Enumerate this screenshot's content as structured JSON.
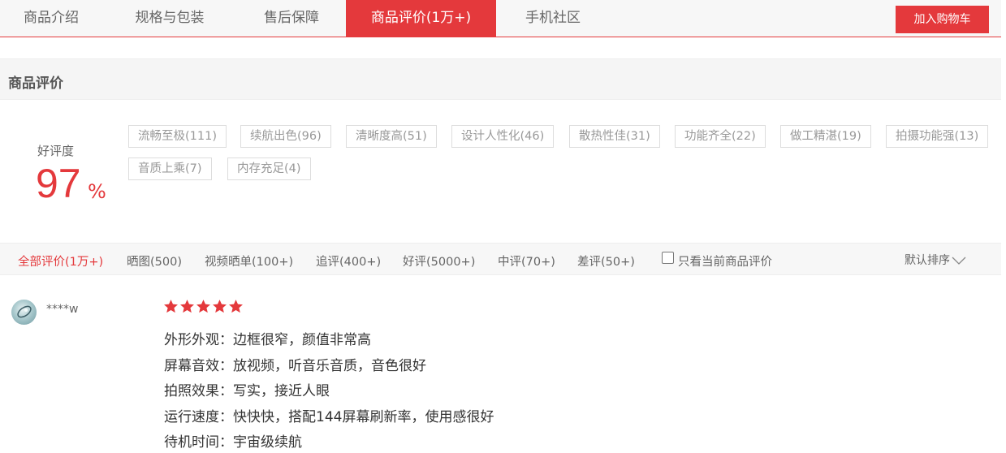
{
  "tabs": [
    {
      "label": "商品介绍"
    },
    {
      "label": "规格与包装"
    },
    {
      "label": "售后保障"
    },
    {
      "label": "商品评价(1万+)"
    },
    {
      "label": "手机社区"
    }
  ],
  "cart_button": "加入购物车",
  "section_title": "商品评价",
  "rating": {
    "label": "好评度",
    "value": "97",
    "unit": "%"
  },
  "tags": [
    "流畅至极(111)",
    "续航出色(96)",
    "清晰度高(51)",
    "设计人性化(46)",
    "散热性佳(31)",
    "功能齐全(22)",
    "做工精湛(19)",
    "拍摄功能强(13)",
    "音质上乘(7)",
    "内存充足(4)"
  ],
  "filters": [
    "全部评价(1万+)",
    "晒图(500)",
    "视频晒单(100+)",
    "追评(400+)",
    "好评(5000+)",
    "中评(70+)",
    "差评(50+)"
  ],
  "current_only_label": "只看当前商品评价",
  "sort_label": "默认排序",
  "review": {
    "username": "****w",
    "stars": 5,
    "lines": [
      "外形外观：边框很窄，颜值非常高",
      "屏幕音效：放视频，听音乐音质，音色很好",
      "拍照效果：写实，接近人眼",
      "运行速度：快快快，搭配144屏幕刷新率，使用感很好",
      "待机时间：宇宙级续航"
    ]
  },
  "colors": {
    "accent": "#e4393c"
  }
}
